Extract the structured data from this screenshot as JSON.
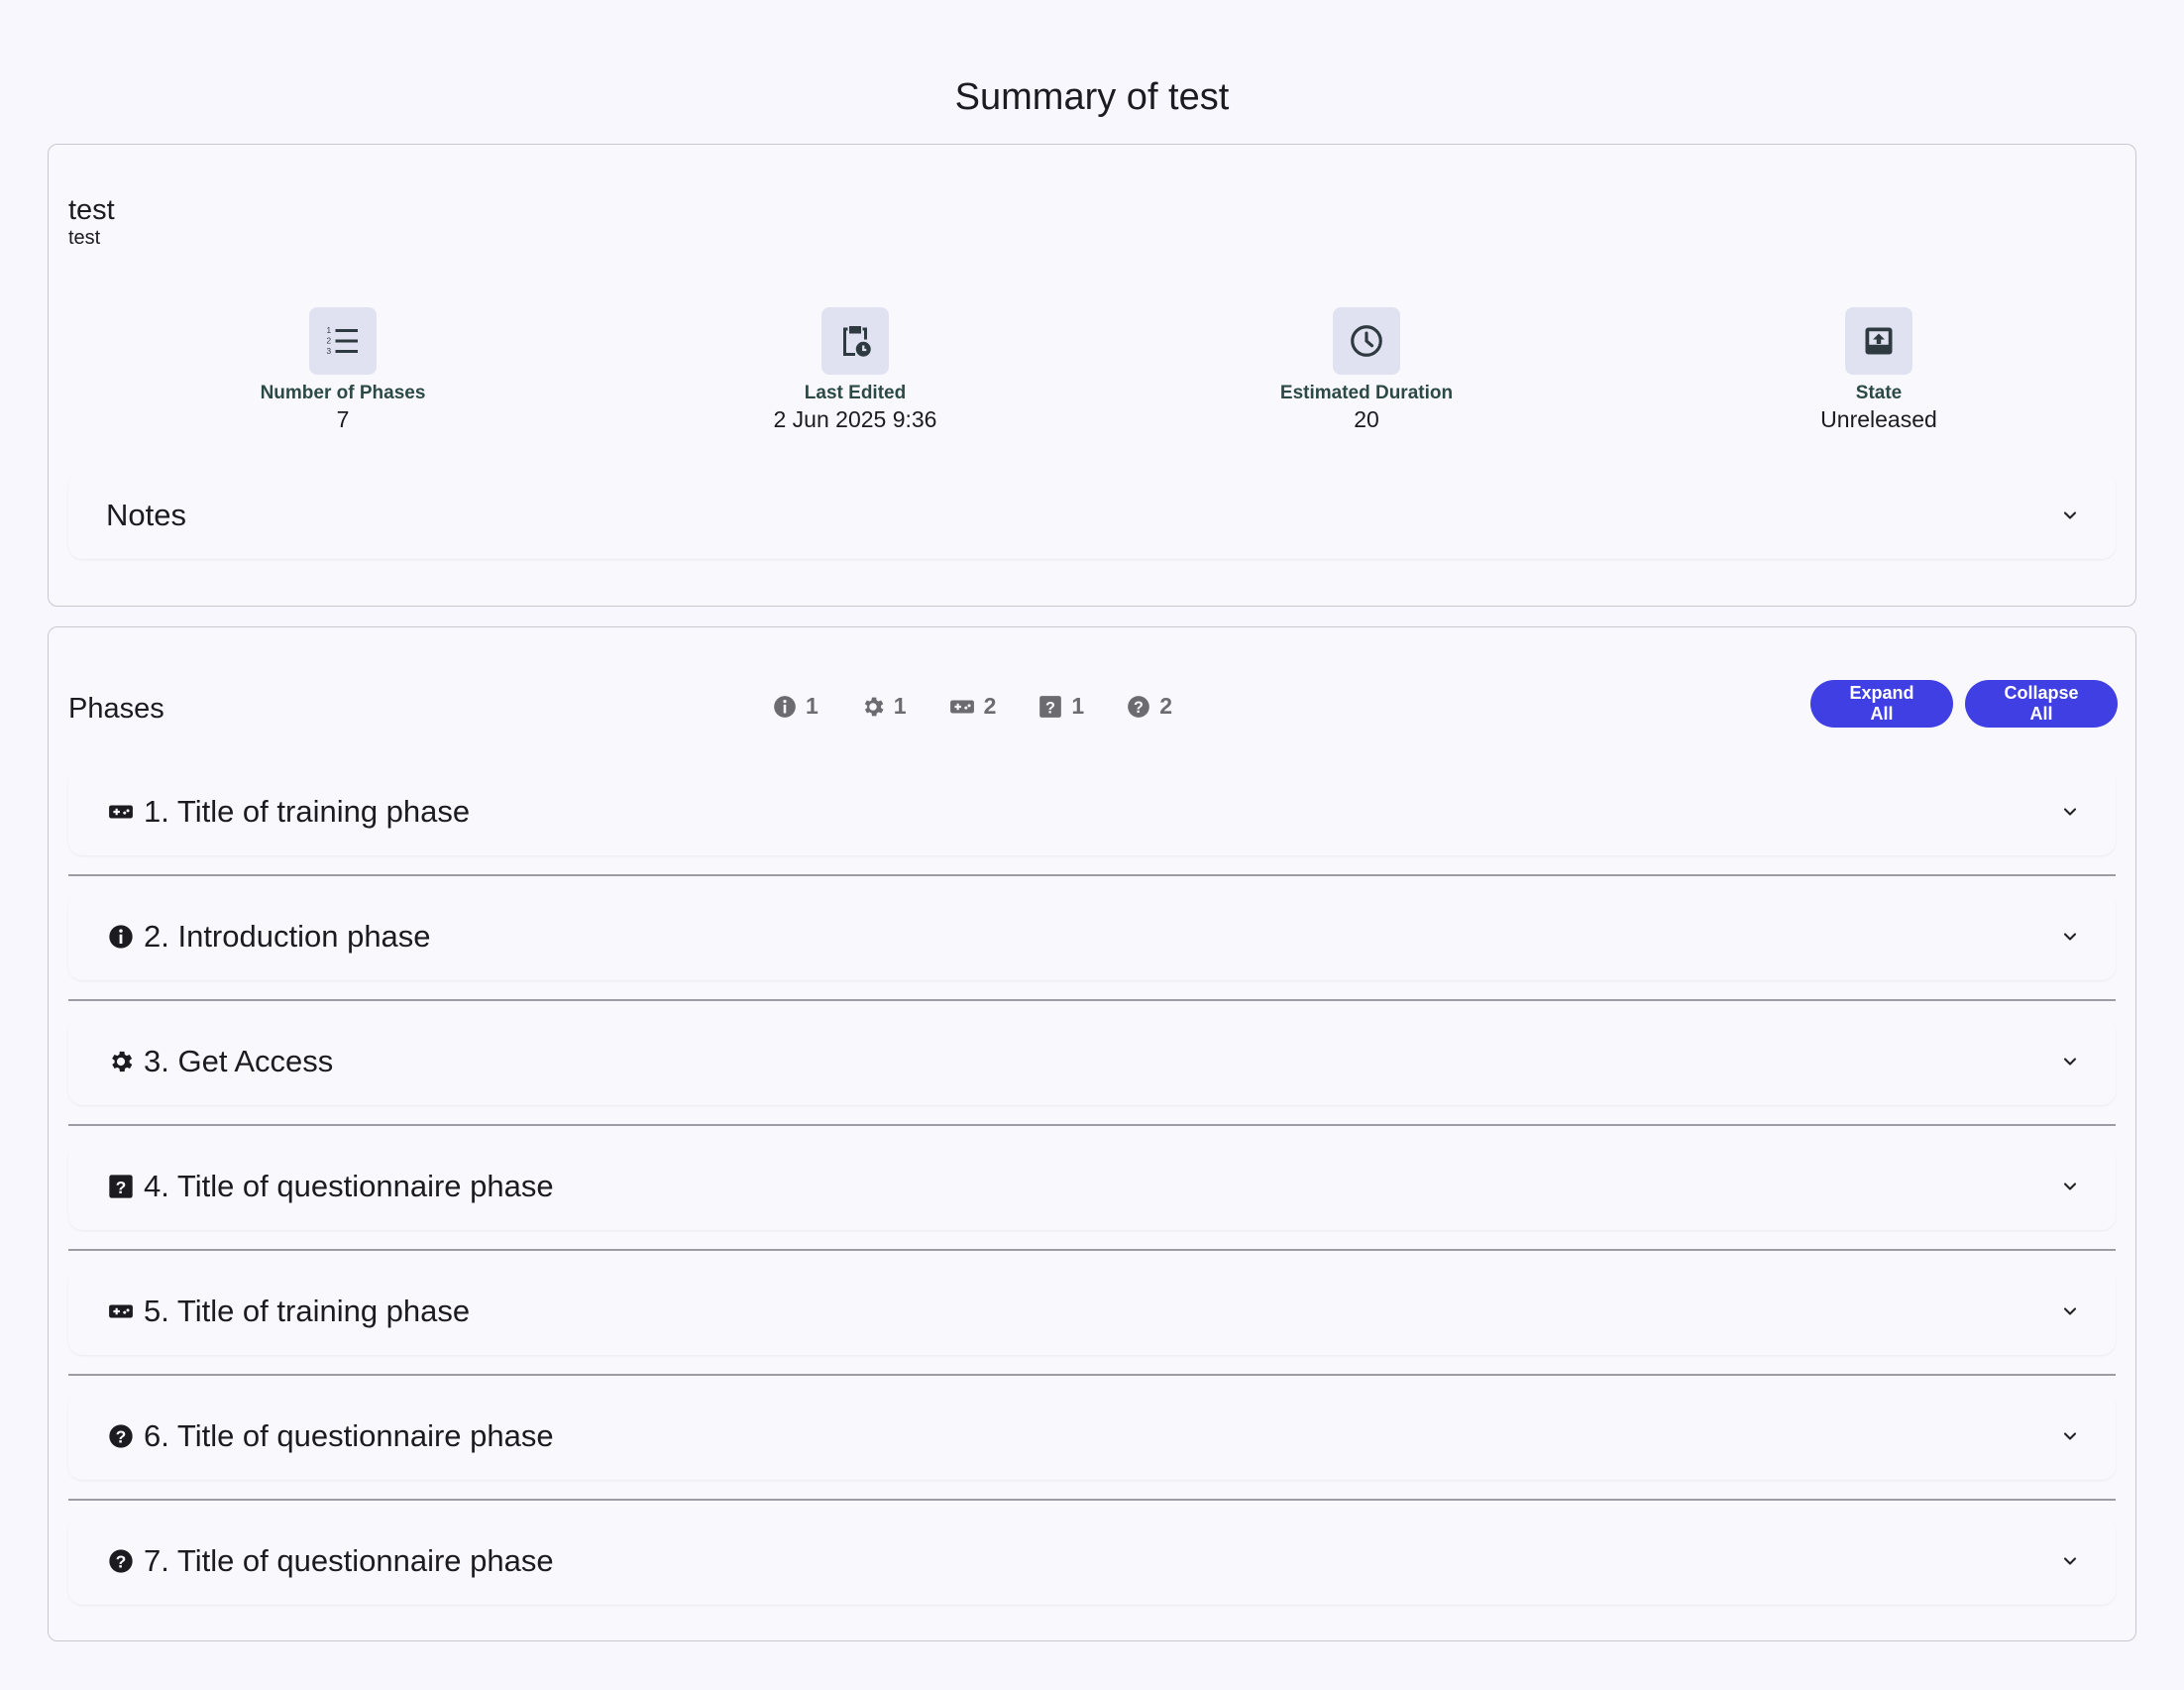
{
  "page": {
    "title": "Summary of test"
  },
  "experiment": {
    "title": "test",
    "subtitle": "test"
  },
  "stats": [
    {
      "icon": "numbered-list-icon",
      "label": "Number of Phases",
      "value": "7"
    },
    {
      "icon": "clipboard-clock-icon",
      "label": "Last Edited",
      "value": "2 Jun 2025 9:36"
    },
    {
      "icon": "clock-icon",
      "label": "Estimated Duration",
      "value": "20"
    },
    {
      "icon": "upload-box-icon",
      "label": "State",
      "value": "Unreleased"
    }
  ],
  "notes": {
    "label": "Notes"
  },
  "phases": {
    "title": "Phases",
    "counts": [
      {
        "icon": "info-icon",
        "value": "1"
      },
      {
        "icon": "gear-icon",
        "value": "1"
      },
      {
        "icon": "gamepad-icon",
        "value": "2"
      },
      {
        "icon": "question-square-icon",
        "value": "1"
      },
      {
        "icon": "question-circle-icon",
        "value": "2"
      }
    ],
    "expand_label": "Expand All",
    "collapse_label": "Collapse All",
    "items": [
      {
        "icon": "gamepad-icon",
        "label": "1. Title of training phase"
      },
      {
        "icon": "info-icon",
        "label": "2. Introduction phase"
      },
      {
        "icon": "gear-icon",
        "label": "3. Get Access"
      },
      {
        "icon": "question-square-icon",
        "label": "4. Title of questionnaire phase"
      },
      {
        "icon": "gamepad-icon",
        "label": "5. Title of training phase"
      },
      {
        "icon": "question-circle-icon",
        "label": "6. Title of questionnaire phase"
      },
      {
        "icon": "question-circle-icon",
        "label": "7. Title of questionnaire phase"
      }
    ]
  },
  "colors": {
    "accent": "#3f3fe3",
    "stat_label": "#2c4a45",
    "icon_bg": "#e1e2f1"
  }
}
